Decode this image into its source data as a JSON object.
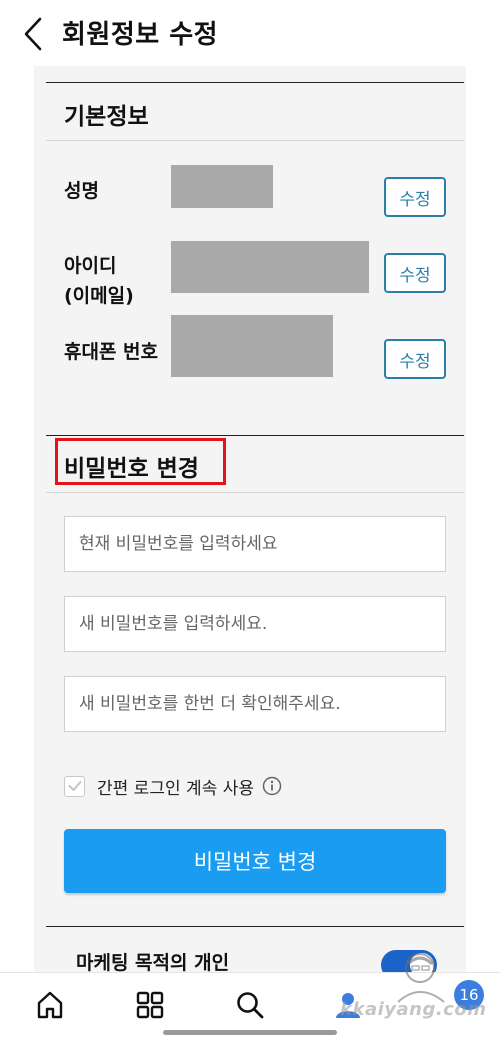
{
  "header": {
    "title": "회원정보 수정"
  },
  "basic_info": {
    "title": "기본정보",
    "fields": [
      {
        "label": "성명",
        "edit_label": "수정"
      },
      {
        "label_line1": "아이디",
        "label_line2": "(이메일)",
        "edit_label": "수정"
      },
      {
        "label": "휴대폰 번호",
        "edit_label": "수정"
      }
    ]
  },
  "password_change": {
    "title": "비밀번호 변경",
    "current_placeholder": "현재 비밀번호를 입력하세요",
    "new_placeholder": "새 비밀번호를 입력하세요.",
    "confirm_placeholder": "새 비밀번호를 한번 더 확인해주세요.",
    "keep_login_label": "간편 로그인 계속 사용",
    "keep_login_checked": true,
    "submit_label": "비밀번호 변경"
  },
  "marketing": {
    "label": "마케팅 목적의 개인",
    "toggle_on": true
  },
  "nav": {
    "items": [
      "home-icon",
      "grid-icon",
      "search-icon",
      "person-icon"
    ],
    "badge_count": "16"
  },
  "watermark": {
    "text": "kkaiyang.com"
  },
  "colors": {
    "accent": "#1a9cf0",
    "edit_button": "#2a7fa8",
    "highlight": "#e2141a",
    "mask": "#a9a9a9",
    "toggle": "#1a63c9"
  }
}
